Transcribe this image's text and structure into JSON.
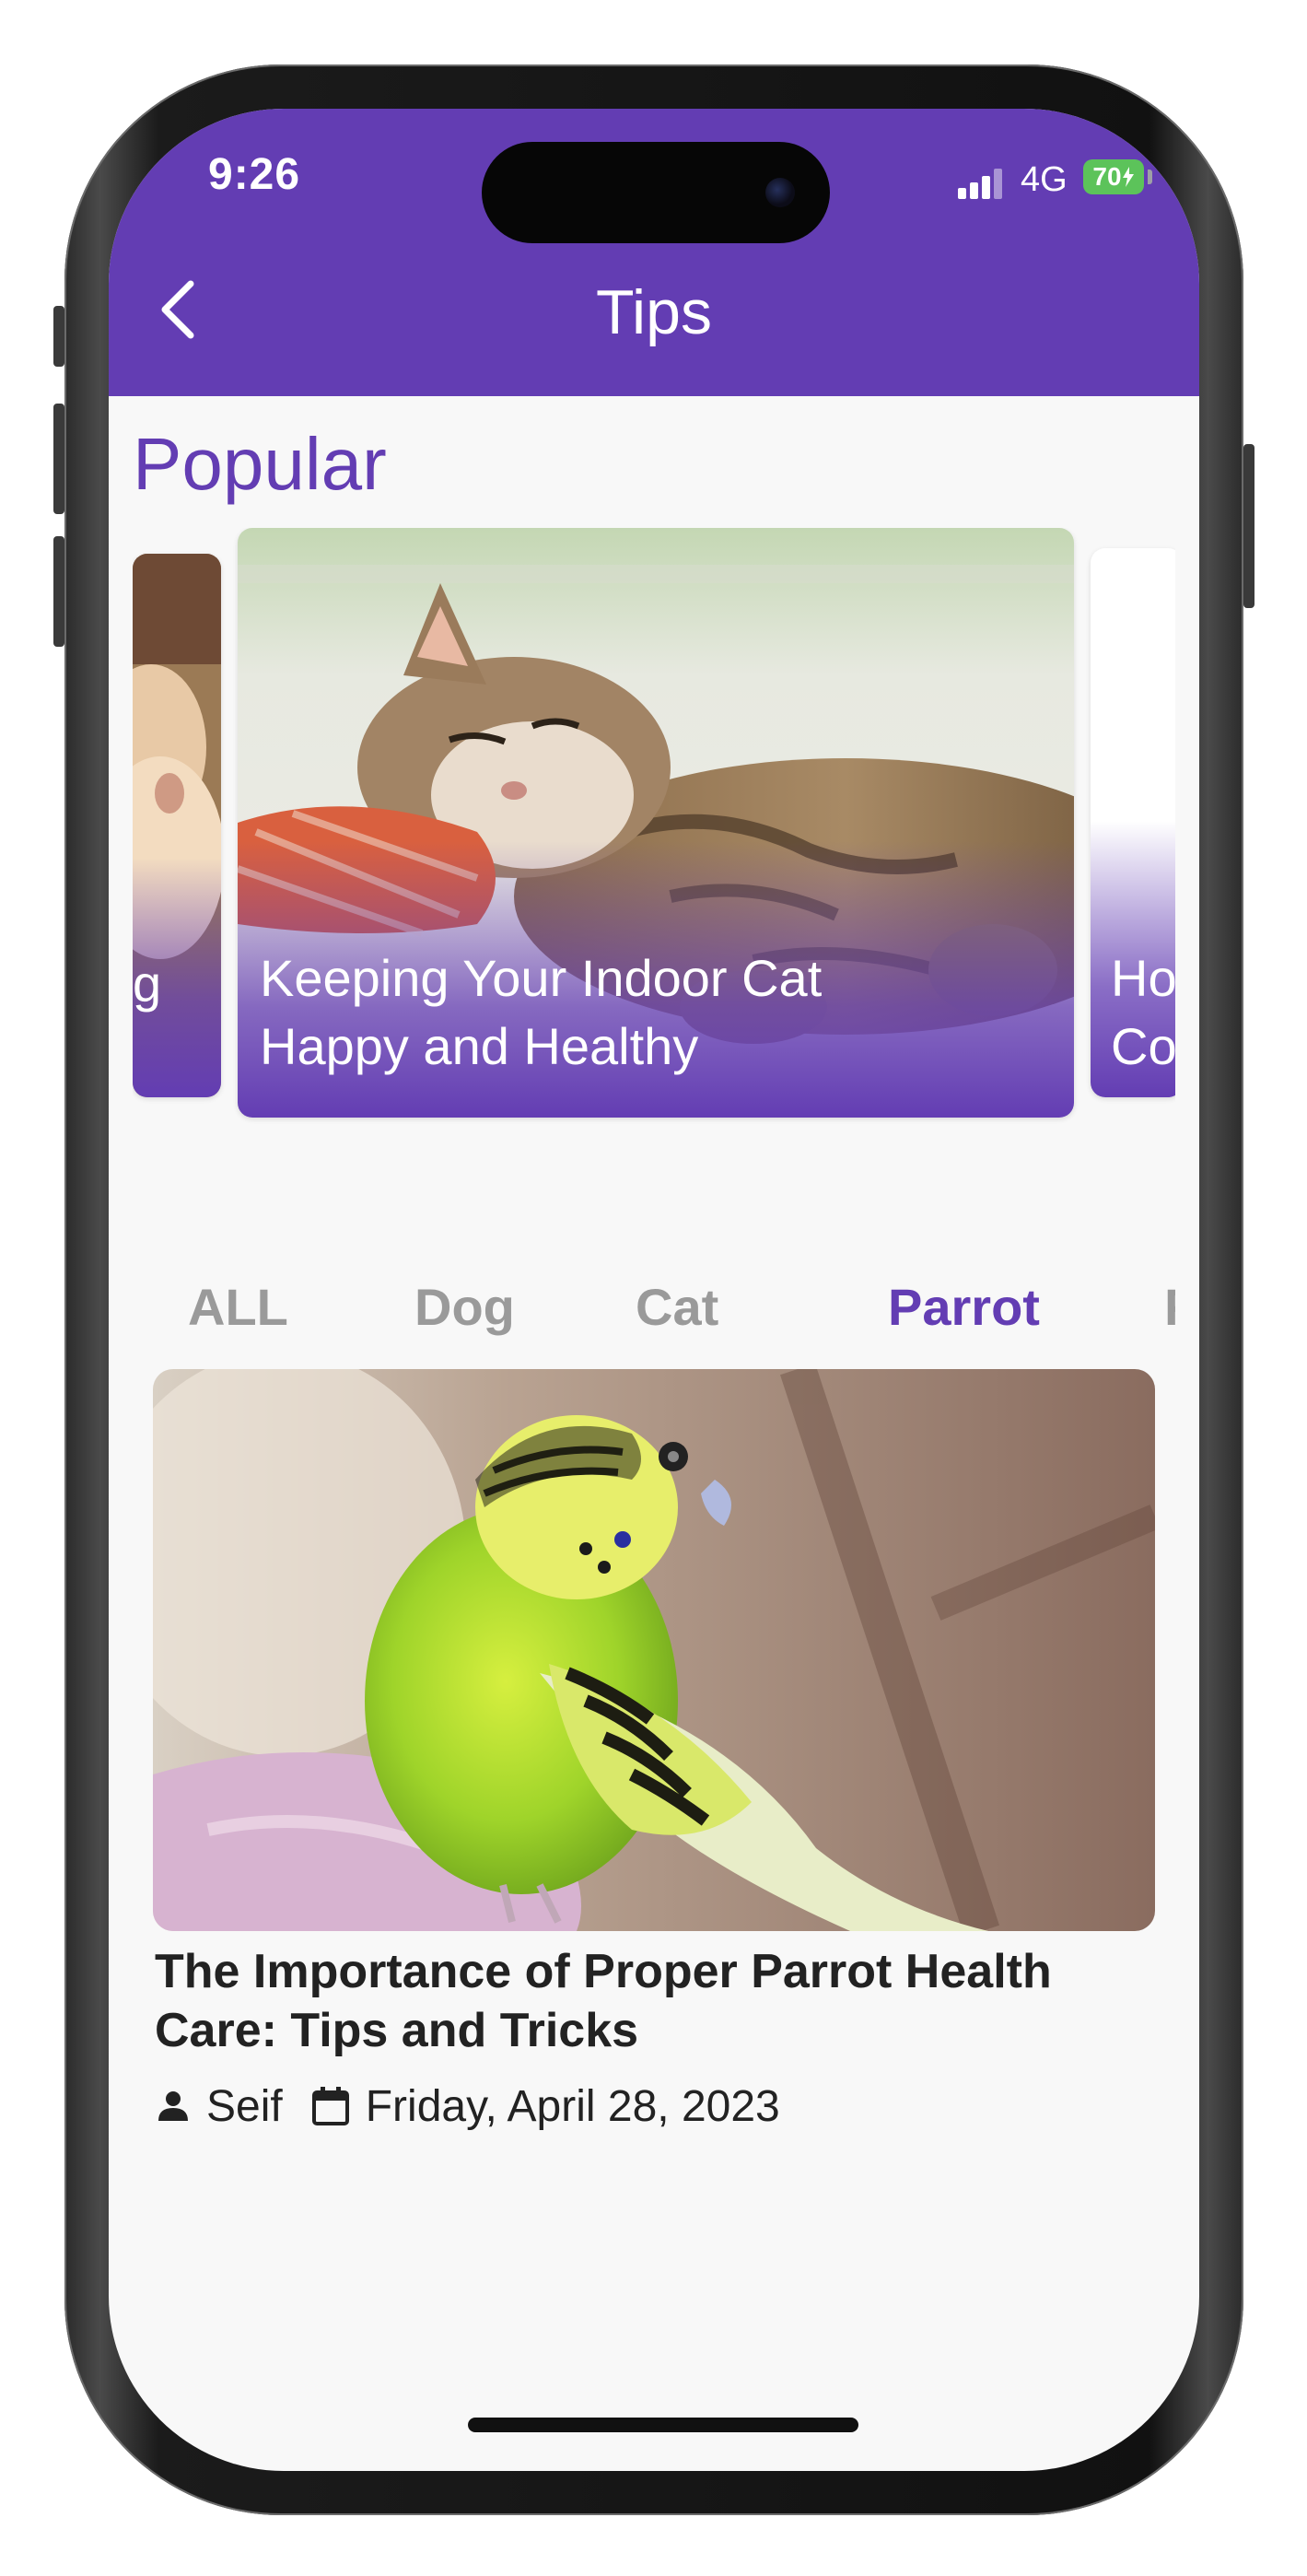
{
  "status_bar": {
    "time": "9:26",
    "network": "4G",
    "battery": "70"
  },
  "app_bar": {
    "title": "Tips",
    "back_icon": "chevron-left-icon"
  },
  "popular": {
    "heading": "Popular",
    "cards": [
      {
        "title_line1": "",
        "title_line2": "g",
        "image": "dog-photo"
      },
      {
        "title_line1": "Keeping Your Indoor Cat",
        "title_line2": "Happy and Healthy",
        "image": "sleeping-cat-photo"
      },
      {
        "title_line1": "Ho",
        "title_line2": "Co",
        "image": "next-card-photo"
      }
    ]
  },
  "tabs": [
    {
      "label": "ALL",
      "active": false
    },
    {
      "label": "Dog",
      "active": false
    },
    {
      "label": "Cat",
      "active": false
    },
    {
      "label": "Parrot",
      "active": true
    },
    {
      "label": "Fi",
      "active": false
    }
  ],
  "article": {
    "image": "budgie-parrot-photo",
    "title": "The Importance of Proper Parrot Health Care: Tips and Tricks",
    "author": "Seif",
    "date": "Friday, April 28, 2023",
    "author_icon": "person-icon",
    "date_icon": "calendar-icon"
  },
  "colors": {
    "primary": "#633db3",
    "tab_inactive": "#9a9a9a",
    "background": "#f8f8f8",
    "battery": "#5cc35a"
  }
}
